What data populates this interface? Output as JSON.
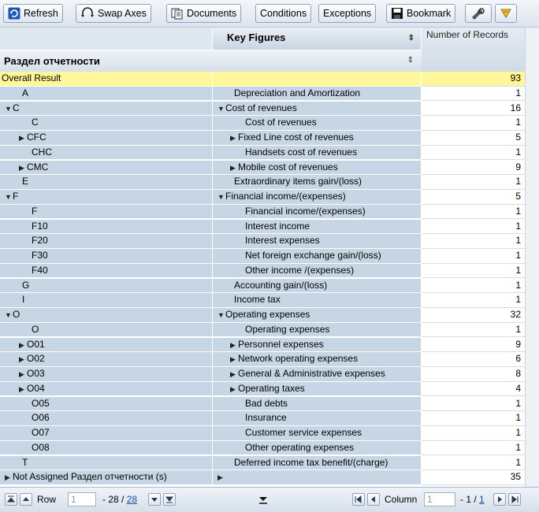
{
  "toolbar": {
    "buttons": [
      {
        "label": "Refresh"
      },
      {
        "label": "Swap Axes"
      },
      {
        "label": "Documents"
      },
      {
        "label": "Conditions"
      },
      {
        "label": "Exceptions"
      },
      {
        "label": "Bookmark"
      }
    ]
  },
  "header": {
    "key_figures": "Key Figures",
    "number_of_records": "Number of Records",
    "row_dimension": "Раздел отчетности"
  },
  "rows": [
    {
      "c1": "Overall Result",
      "c2": "",
      "value": "93",
      "overall": true
    },
    {
      "c1": "A",
      "c2": "Depreciation and Amortization",
      "value": "1"
    },
    {
      "c1": "C",
      "c2": "Cost of revenues",
      "value": "16",
      "exp1": "open",
      "exp2": "open"
    },
    {
      "c1": "C",
      "c2": "Cost of revenues",
      "value": "1"
    },
    {
      "c1": "CFC",
      "c2": "Fixed Line cost of revenues",
      "value": "5",
      "exp1": "closed",
      "exp2": "closed"
    },
    {
      "c1": "CHC",
      "c2": "Handsets cost of revenues",
      "value": "1"
    },
    {
      "c1": "CMC",
      "c2": "Mobile cost of revenues",
      "value": "9",
      "exp1": "closed",
      "exp2": "closed"
    },
    {
      "c1": "E",
      "c2": "Extraordinary items gain/(loss)",
      "value": "1"
    },
    {
      "c1": "F",
      "c2": "Financial income/(expenses)",
      "value": "5",
      "exp1": "open",
      "exp2": "open"
    },
    {
      "c1": "F",
      "c2": "Financial income/(expenses)",
      "value": "1"
    },
    {
      "c1": "F10",
      "c2": "Interest income",
      "value": "1"
    },
    {
      "c1": "F20",
      "c2": "Interest expenses",
      "value": "1"
    },
    {
      "c1": "F30",
      "c2": "Net foreign exchange gain/(loss)",
      "value": "1"
    },
    {
      "c1": "F40",
      "c2": "Other income /(expenses)",
      "value": "1"
    },
    {
      "c1": "G",
      "c2": "Accounting  gain/(loss)",
      "value": "1"
    },
    {
      "c1": "I",
      "c2": "Income tax",
      "value": "1"
    },
    {
      "c1": "O",
      "c2": "Operating expenses",
      "value": "32",
      "exp1": "open",
      "exp2": "open"
    },
    {
      "c1": "O",
      "c2": "Operating expenses",
      "value": "1"
    },
    {
      "c1": "O01",
      "c2": "Personnel expenses",
      "value": "9",
      "exp1": "closed",
      "exp2": "closed"
    },
    {
      "c1": "O02",
      "c2": "Network operating expenses",
      "value": "6",
      "exp1": "closed",
      "exp2": "closed"
    },
    {
      "c1": "O03",
      "c2": "General & Administrative expenses",
      "value": "8",
      "exp1": "closed",
      "exp2": "closed"
    },
    {
      "c1": "O04",
      "c2": "Operating taxes",
      "value": "4",
      "exp1": "closed",
      "exp2": "closed"
    },
    {
      "c1": "O05",
      "c2": "Bad debts",
      "value": "1"
    },
    {
      "c1": "O06",
      "c2": "Insurance",
      "value": "1"
    },
    {
      "c1": "O07",
      "c2": "Customer service expenses",
      "value": "1"
    },
    {
      "c1": "O08",
      "c2": "Other operating expenses",
      "value": "1"
    },
    {
      "c1": "T",
      "c2": "Deferred income tax benefit/(charge)",
      "value": "1"
    },
    {
      "c1": "Not Assigned Раздел отчетности (s)",
      "c2": "",
      "value": "35",
      "exp1": "closed",
      "exp2": "closed"
    }
  ],
  "pager": {
    "row_label": "Row",
    "row_value": "1",
    "row_total_text": "- 28 /",
    "row_total_link": "28",
    "column_label": "Column",
    "column_value": "1",
    "column_total_text": "- 1 /",
    "column_total_link": "1"
  }
}
